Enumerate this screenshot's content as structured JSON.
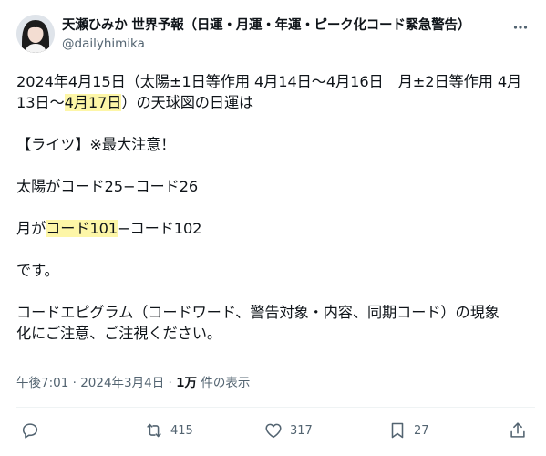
{
  "author": {
    "display_name": "天瀬ひみか 世界予報（日運・月運・年運・ピーク化コード緊急警告）",
    "handle": "@dailyhimika",
    "avatar_icon": "profile-avatar-icon"
  },
  "post": {
    "line1a": "2024年4月15日（太陽±1日等作用 4月14日〜4月16日　月±2日等作用 4月",
    "line1b_pre": "13日〜",
    "line1b_hl": "4月17日",
    "line1b_post": "）の天球図の日運は",
    "line2": "【ライツ】※最大注意！",
    "line3": "太陽がコード25−コード26",
    "line4_pre": "月が",
    "line4_hl": "コード101",
    "line4_post": "−コード102",
    "line5": "です。",
    "line6a": "コードエピグラム（コードワード、警告対象・内容、同期コード）の現象",
    "line6b": "化にご注意、ご注視ください。"
  },
  "meta": {
    "time": "午後7:01",
    "sep1": " · ",
    "date": "2024年3月4日",
    "sep2": " · ",
    "views": "1万",
    "views_suffix": " 件の表示"
  },
  "actions": {
    "reply_count": "",
    "repost_count": "415",
    "like_count": "317",
    "bookmark_count": "27"
  },
  "colors": {
    "text": "#0f1419",
    "secondary": "#536471",
    "highlight": "#fdf6a7"
  }
}
